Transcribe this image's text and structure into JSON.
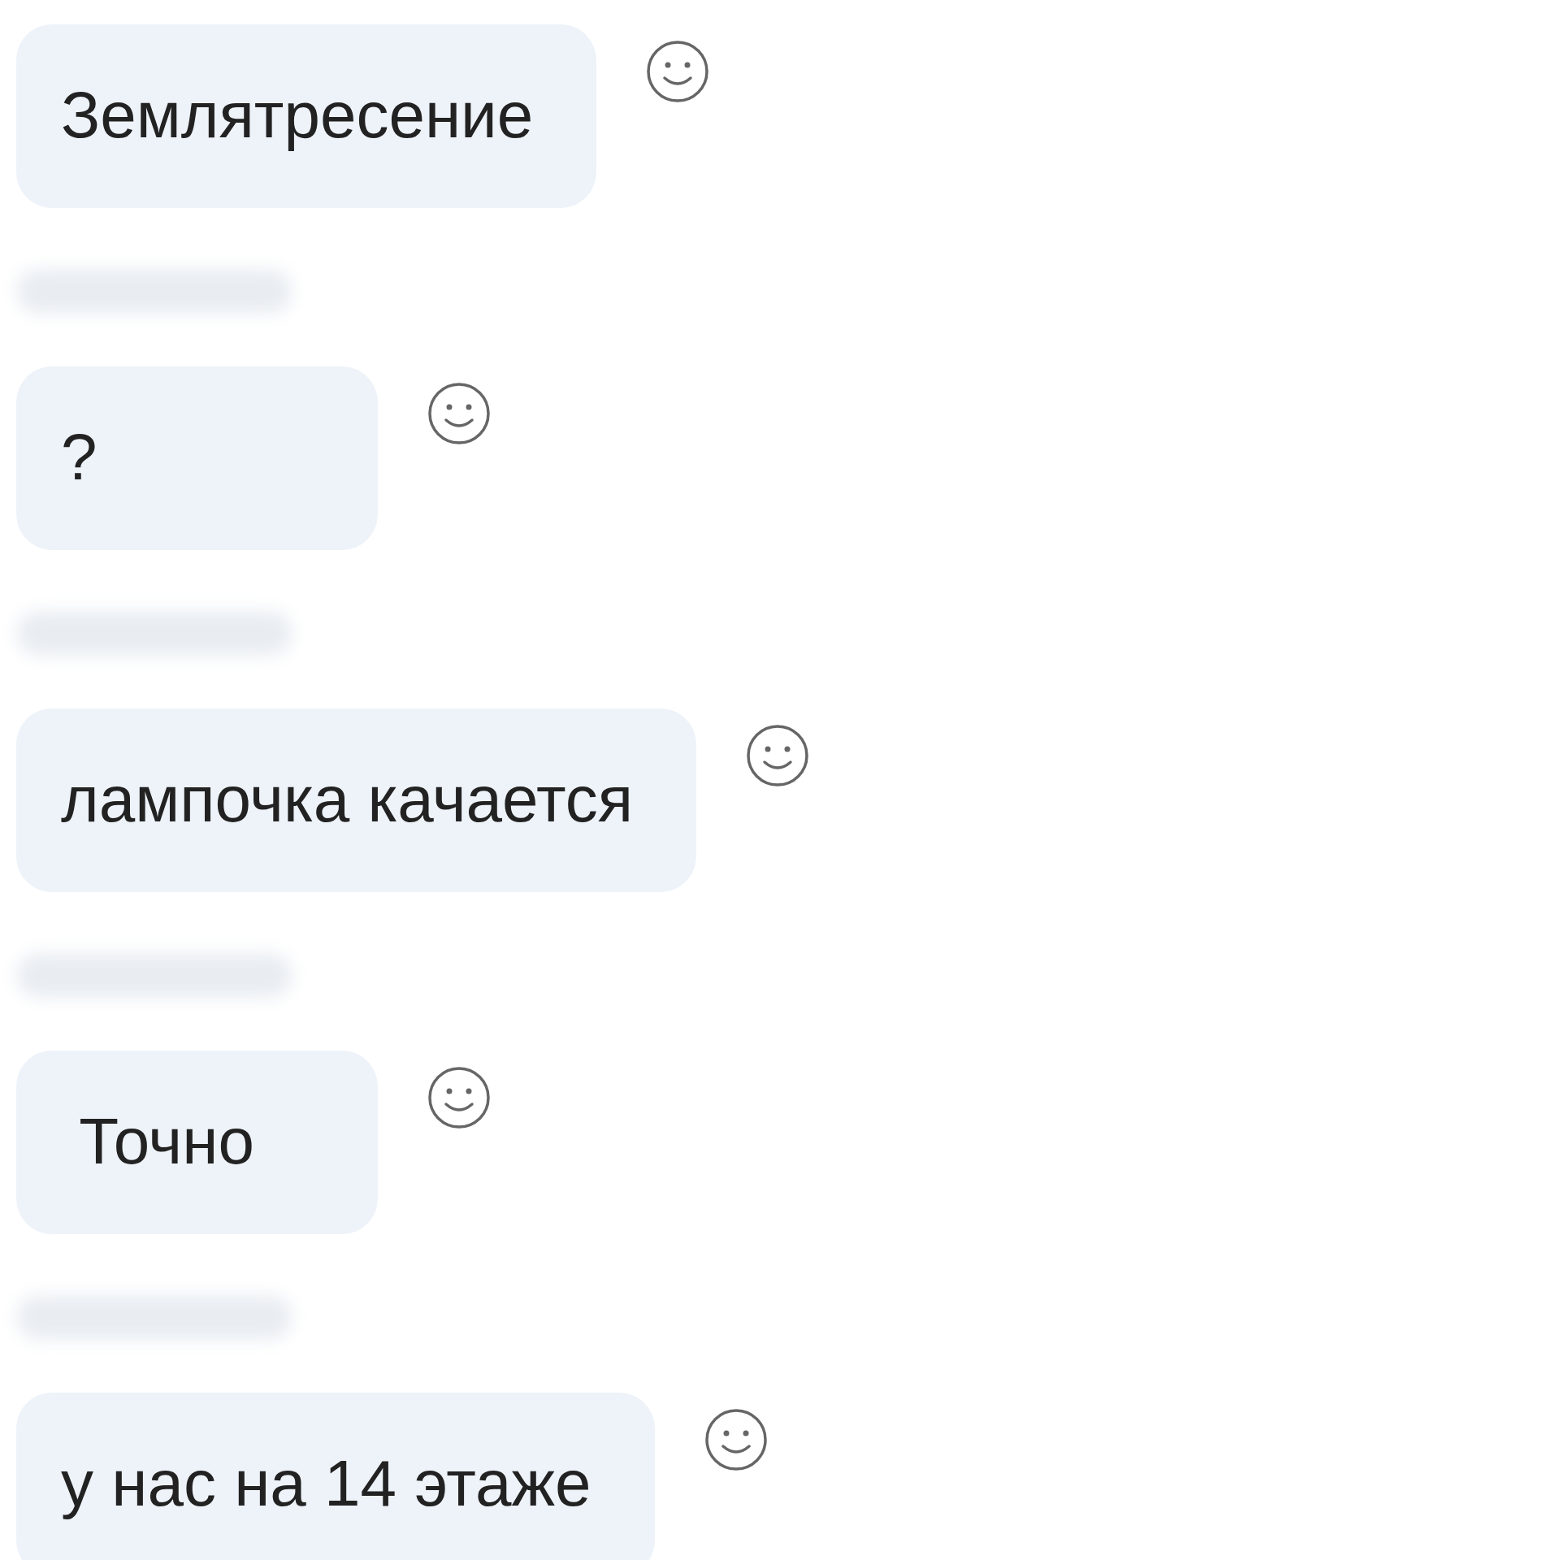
{
  "messages": [
    {
      "text": "Землятресение",
      "sender_blurred": false
    },
    {
      "text": "?",
      "sender_blurred": true
    },
    {
      "text": "лампочка качается",
      "sender_blurred": true
    },
    {
      "text": " Точно",
      "sender_blurred": true
    },
    {
      "text": "у нас на 14 этаже",
      "sender_blurred": true
    }
  ]
}
